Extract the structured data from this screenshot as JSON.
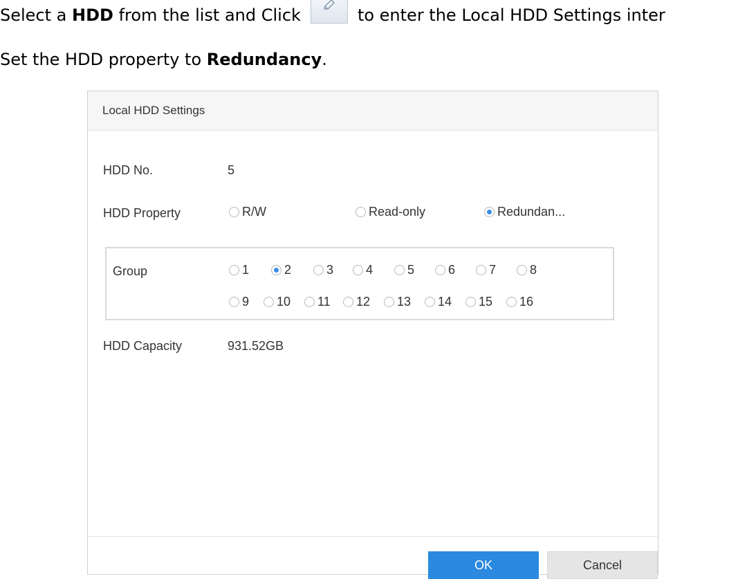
{
  "instructions": {
    "line1": {
      "pre": "Select a ",
      "bold": "HDD",
      "mid": " from the list and Click",
      "post": "to enter the Local HDD Settings inter"
    },
    "line2": {
      "pre": "Set the HDD property to ",
      "bold": "Redundancy",
      "post": "."
    },
    "icon": "edit-icon"
  },
  "dialog": {
    "title": "Local HDD Settings",
    "hdd_no_label": "HDD No.",
    "hdd_no_value": "5",
    "property_label": "HDD Property",
    "property_options": [
      {
        "label": "R/W",
        "checked": false
      },
      {
        "label": "Read-only",
        "checked": false
      },
      {
        "label": "Redundan...",
        "checked": true
      }
    ],
    "group_label": "Group",
    "group_options": [
      "1",
      "2",
      "3",
      "4",
      "5",
      "6",
      "7",
      "8",
      "9",
      "10",
      "11",
      "12",
      "13",
      "14",
      "15",
      "16"
    ],
    "group_selected": "2",
    "capacity_label": "HDD Capacity",
    "capacity_value": "931.52GB",
    "ok_label": "OK",
    "cancel_label": "Cancel"
  },
  "colors": {
    "accent": "#2b89e0",
    "radio_selected": "#3a8ee6"
  }
}
